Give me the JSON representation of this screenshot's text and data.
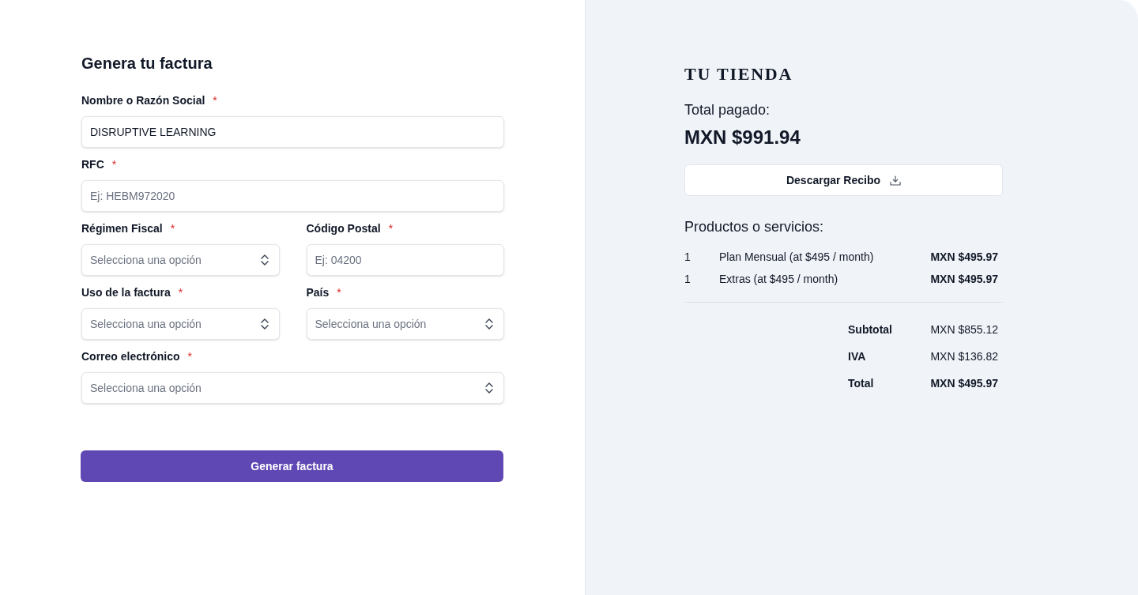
{
  "form": {
    "title": "Genera tu factura",
    "rows": [
      {
        "fields": [
          {
            "label": "Nombre o Razón Social",
            "required_mark": "*",
            "kind": "text",
            "value": "DISRUPTIVE LEARNING"
          }
        ]
      },
      {
        "fields": [
          {
            "label": "RFC",
            "required_mark": "*",
            "kind": "text",
            "placeholder": "Ej: HEBM972020"
          }
        ]
      },
      {
        "fields": [
          {
            "label": "Régimen Fiscal",
            "required_mark": "*",
            "kind": "select",
            "placeholder": "Selecciona una opción"
          },
          {
            "label": "Código Postal",
            "required_mark": "*",
            "kind": "text",
            "placeholder": "Ej: 04200"
          }
        ]
      },
      {
        "fields": [
          {
            "label": "Uso de la factura",
            "required_mark": "*",
            "kind": "select",
            "placeholder": "Selecciona una opción"
          },
          {
            "label": "País",
            "required_mark": "*",
            "kind": "select",
            "placeholder": "Selecciona una opción"
          }
        ]
      },
      {
        "fields": [
          {
            "label": "Correo electrónico",
            "required_mark": "*",
            "kind": "select",
            "placeholder": "Selecciona una opción"
          }
        ]
      }
    ],
    "submit_button": "Generar factura"
  },
  "receipt": {
    "store_name": "TU TIENDA",
    "total_label": "Total pagado:",
    "total_amount": "MXN $991.94",
    "download_button": "Descargar Recibo",
    "items_title": "Productos o servicios:",
    "items": [
      {
        "quantity": "1",
        "description": "Plan Mensual (at $495 / month)",
        "amount": "MXN $495.97"
      },
      {
        "quantity": "1",
        "description": "Extras (at $495 / month)",
        "amount": "MXN $495.97"
      }
    ],
    "summary": [
      {
        "label": "Subtotal",
        "value": "MXN $855.12",
        "emphasized": false
      },
      {
        "label": "IVA",
        "value": "MXN $136.82",
        "emphasized": false
      },
      {
        "label": "Total",
        "value": "MXN $495.97",
        "emphasized": true
      }
    ]
  }
}
